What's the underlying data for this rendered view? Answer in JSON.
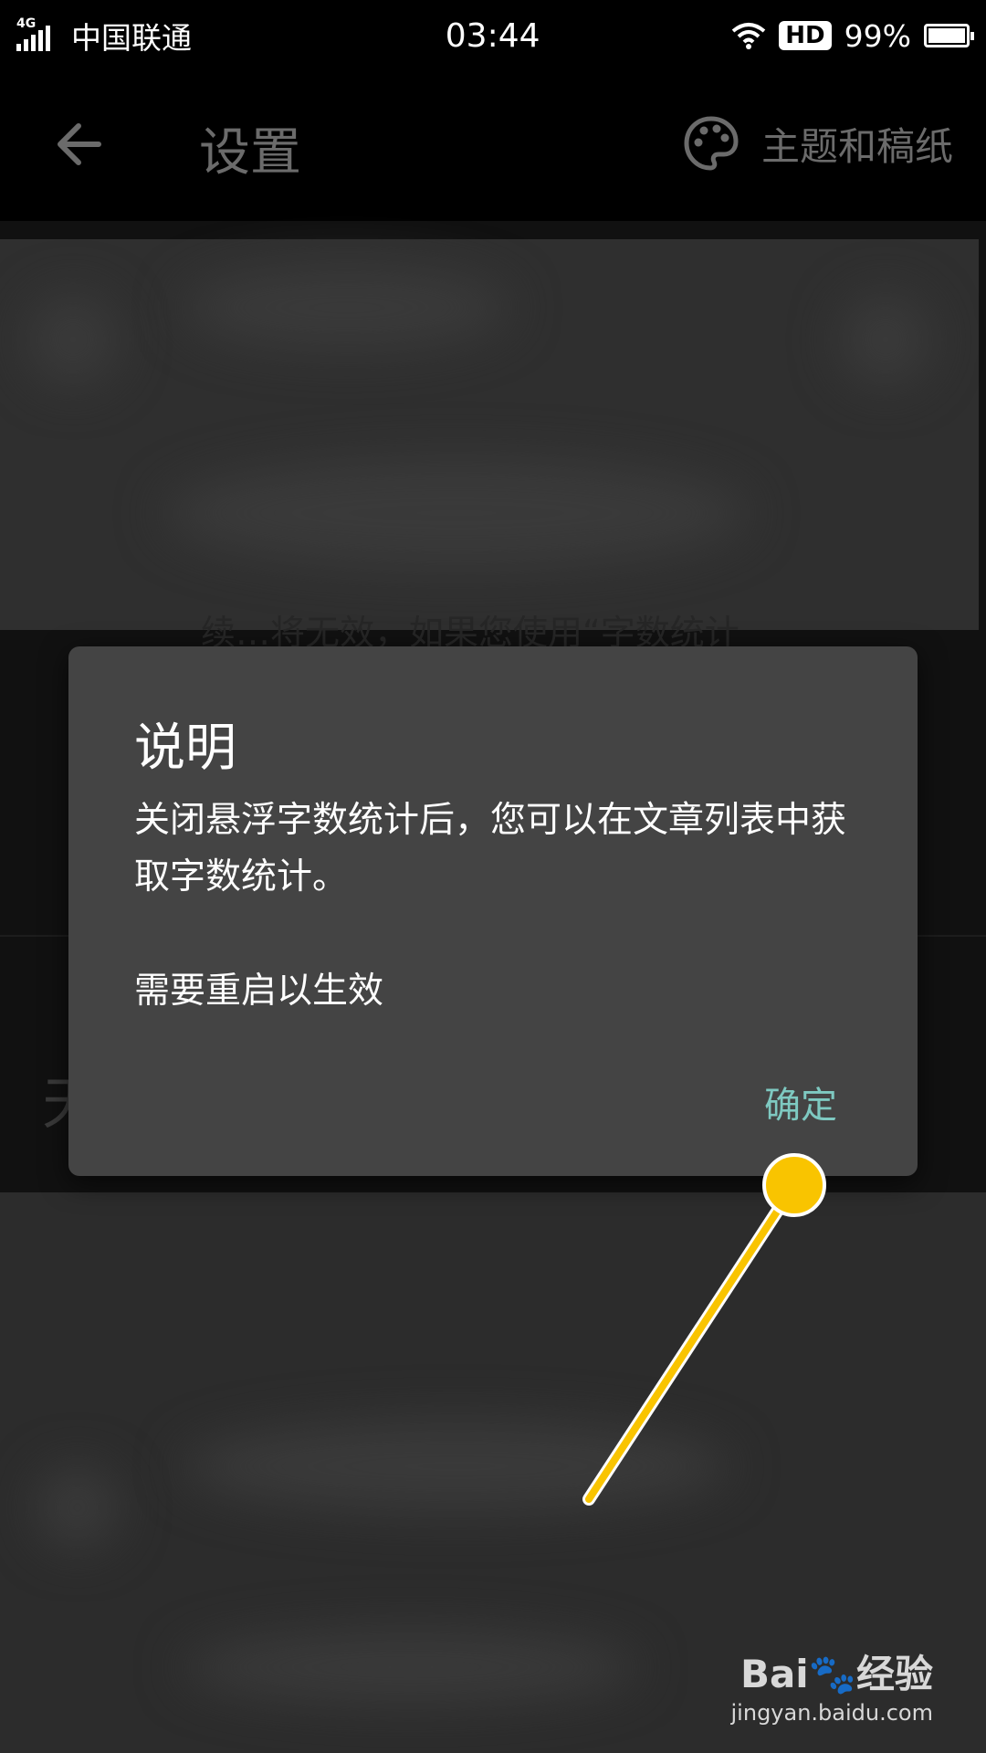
{
  "status_bar": {
    "network": "4G",
    "carrier": "中国联通",
    "time": "03:44",
    "hd_badge": "HD",
    "battery": "99%"
  },
  "app_bar": {
    "title": "设置",
    "theme_label": "主题和稿纸",
    "back_icon": "arrow-left-icon",
    "theme_icon": "palette-icon"
  },
  "background": {
    "faded_text": "续…将无效，如果您使用“字数统计",
    "partial_char": "天"
  },
  "dialog": {
    "title": "说明",
    "message": "关闭悬浮字数统计后，您可以在文章列表中获取字数统计。",
    "note": "需要重启以生效",
    "confirm_label": "确定"
  },
  "watermark": {
    "logo": "Bai🐾经验",
    "url": "jingyan.baidu.com"
  },
  "colors": {
    "dialog_bg": "#444444",
    "accent": "#7ec9c1",
    "pointer": "#f9c400",
    "app_bar_text": "#6b6b6b"
  }
}
